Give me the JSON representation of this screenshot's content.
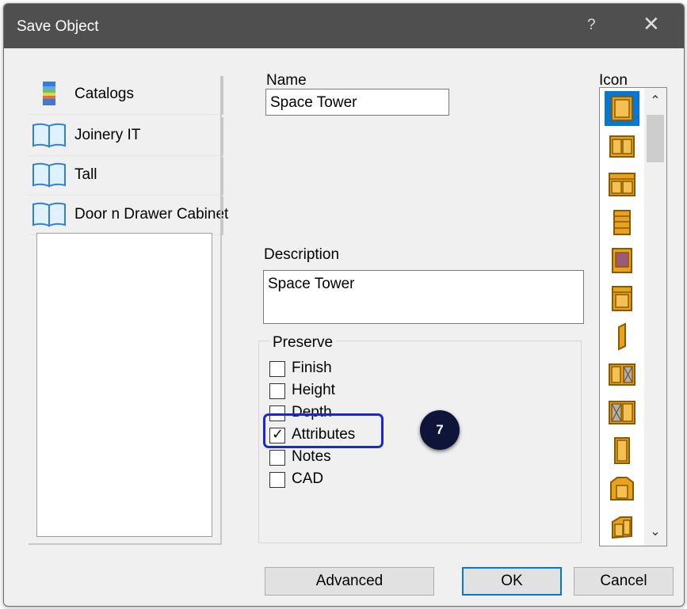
{
  "window": {
    "title": "Save Object",
    "help_glyph": "?",
    "close_glyph": "✕"
  },
  "catalogs": [
    {
      "label": "Catalogs",
      "icon": "catalog-stack-icon"
    },
    {
      "label": "Joinery IT",
      "icon": "open-book-icon"
    },
    {
      "label": "Tall",
      "icon": "open-book-icon"
    },
    {
      "label": "Door n Drawer Cabinet",
      "icon": "open-book-icon"
    }
  ],
  "name": {
    "label": "Name",
    "value": "Space Tower"
  },
  "description": {
    "label": "Description",
    "value": "Space Tower"
  },
  "preserve": {
    "legend": "Preserve",
    "options": [
      {
        "label": "Finish",
        "checked": false
      },
      {
        "label": "Height",
        "checked": false
      },
      {
        "label": "Depth",
        "checked": false
      },
      {
        "label": "Attributes",
        "checked": true
      },
      {
        "label": "Notes",
        "checked": false
      },
      {
        "label": "CAD",
        "checked": false
      }
    ]
  },
  "icon_panel": {
    "label": "Icon",
    "scroll_up": "⌃",
    "scroll_down": "⌄",
    "items": [
      "cabinet-single-door-icon",
      "cabinet-double-door-icon",
      "cabinet-wide-double-door-icon",
      "drawer-stack-icon",
      "cabinet-finished-panel-icon",
      "cabinet-drawer-door-icon",
      "end-panel-icon",
      "cabinet-glass-door-icon",
      "cabinet-double-glass-icon",
      "tall-door-icon",
      "corner-angle-cabinet-icon",
      "corner-l-cabinet-icon"
    ]
  },
  "buttons": {
    "advanced": "Advanced",
    "ok": "OK",
    "cancel": "Cancel"
  },
  "annotation": {
    "step": "7"
  },
  "colors": {
    "titlebar": "#4f4f4f",
    "highlight": "#1d27cf",
    "badge": "#0e1538",
    "cabinet_fill": "#e8a21f",
    "cabinet_stroke": "#8a5a00",
    "selection": "#0078d7"
  }
}
